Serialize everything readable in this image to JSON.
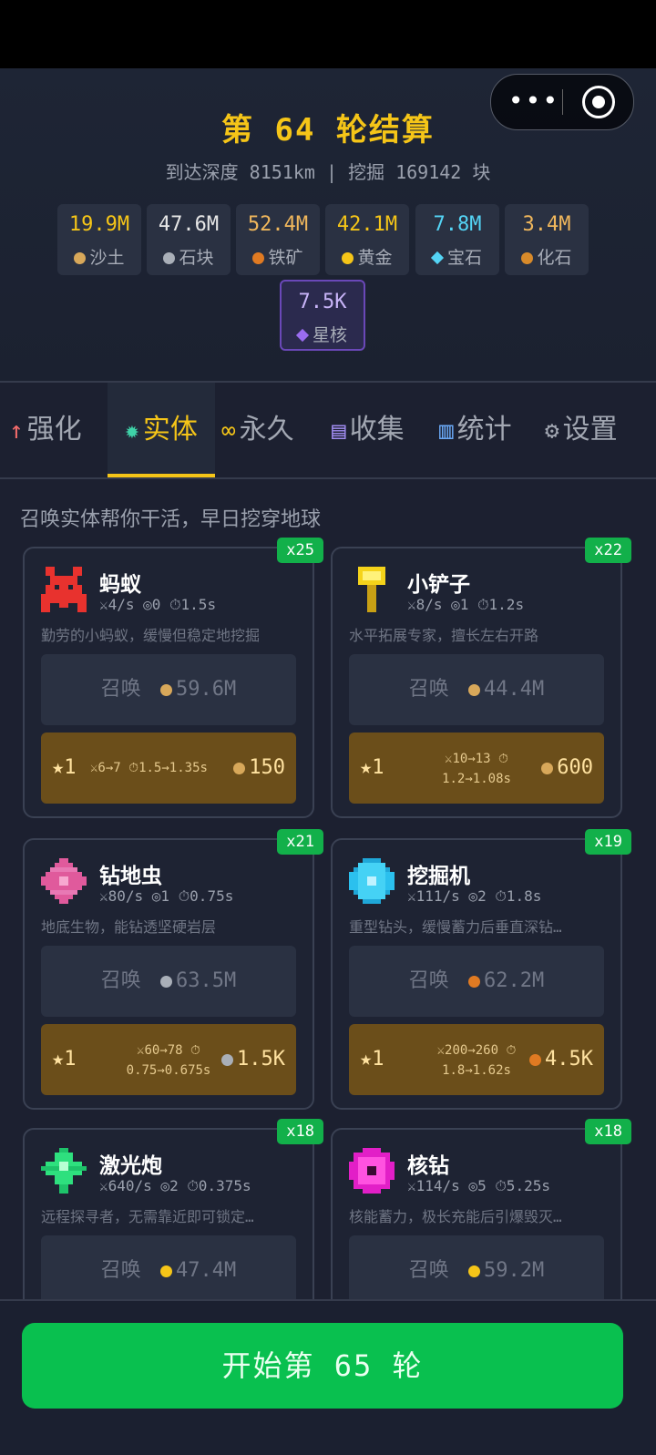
{
  "header": {
    "title": "第 64 轮结算",
    "subtitle": "到达深度 8151km | 挖掘 169142 块"
  },
  "resources": [
    {
      "value": "19.9M",
      "label": "沙土",
      "color": "#f5c518",
      "icon": "sand-icon"
    },
    {
      "value": "47.6M",
      "label": "石块",
      "color": "#e6e6e6",
      "icon": "stone-icon"
    },
    {
      "value": "52.4M",
      "label": "铁矿",
      "color": "#f0b75c",
      "icon": "iron-ore-icon"
    },
    {
      "value": "42.1M",
      "label": "黄金",
      "color": "#f5c518",
      "icon": "gold-icon"
    },
    {
      "value": "7.8M",
      "label": "宝石",
      "color": "#54d4f5",
      "icon": "gem-icon"
    },
    {
      "value": "3.4M",
      "label": "化石",
      "color": "#f0b75c",
      "icon": "fossil-icon"
    },
    {
      "value": "7.5K",
      "label": "星核",
      "color": "#b89cf5",
      "icon": "star-core-icon"
    }
  ],
  "tabs": [
    {
      "icon": "↑",
      "label": "强化",
      "icon_color": "#f26b6b"
    },
    {
      "icon": "✹",
      "label": "实体",
      "icon_color": "#3fd2a8"
    },
    {
      "icon": "∞",
      "label": "永久",
      "icon_color": "#f5c518"
    },
    {
      "icon": "▤",
      "label": "收集",
      "icon_color": "#a08cf0"
    },
    {
      "icon": "▥",
      "label": "统计",
      "icon_color": "#6aa8f5"
    },
    {
      "icon": "⚙",
      "label": "设置",
      "icon_color": "#a2a7b2"
    }
  ],
  "hint": "召唤实体帮你干活，早日挖穿地球",
  "entities": [
    {
      "name": "蚂蚁",
      "count": "x25",
      "stats": "⚔4/s ◎0 ⏱1.5s",
      "desc": "勤劳的小蚂蚁，缓慢但稳定地挖掘",
      "summon_label": "召唤",
      "summon_cost": "59.6M",
      "summon_icon": "sand-icon",
      "upgrade_level": "★1",
      "upgrade_line1": "⚔6→7 ⏱1.5→1.35s",
      "upgrade_line2": "",
      "upgrade_cost": "150",
      "upgrade_icon": "sand-icon"
    },
    {
      "name": "小铲子",
      "count": "x22",
      "stats": "⚔8/s ◎1 ⏱1.2s",
      "desc": "水平拓展专家，擅长左右开路",
      "summon_label": "召唤",
      "summon_cost": "44.4M",
      "summon_icon": "sand-icon",
      "upgrade_level": "★1",
      "upgrade_line1": "⚔10→13 ⏱",
      "upgrade_line2": "1.2→1.08s",
      "upgrade_cost": "600",
      "upgrade_icon": "sand-icon"
    },
    {
      "name": "钻地虫",
      "count": "x21",
      "stats": "⚔80/s ◎1 ⏱0.75s",
      "desc": "地底生物，能钻透坚硬岩层",
      "summon_label": "召唤",
      "summon_cost": "63.5M",
      "summon_icon": "stone-icon",
      "upgrade_level": "★1",
      "upgrade_line1": "⚔60→78 ⏱",
      "upgrade_line2": "0.75→0.675s",
      "upgrade_cost": "1.5K",
      "upgrade_icon": "stone-icon"
    },
    {
      "name": "挖掘机",
      "count": "x19",
      "stats": "⚔111/s ◎2 ⏱1.8s",
      "desc": "重型钻头，缓慢蓄力后垂直深钻…",
      "summon_label": "召唤",
      "summon_cost": "62.2M",
      "summon_icon": "iron-ore-icon",
      "upgrade_level": "★1",
      "upgrade_line1": "⚔200→260 ⏱",
      "upgrade_line2": "1.8→1.62s",
      "upgrade_cost": "4.5K",
      "upgrade_icon": "iron-ore-icon"
    },
    {
      "name": "激光炮",
      "count": "x18",
      "stats": "⚔640/s ◎2 ⏱0.375s",
      "desc": "远程探寻者，无需靠近即可锁定…",
      "summon_label": "召唤",
      "summon_cost": "47.4M",
      "summon_icon": "gold-icon"
    },
    {
      "name": "核钻",
      "count": "x18",
      "stats": "⚔114/s ◎5 ⏱5.25s",
      "desc": "核能蓄力，极长充能后引爆毁灭…",
      "summon_label": "召唤",
      "summon_cost": "59.2M",
      "summon_icon": "gold-icon"
    }
  ],
  "start_button": "开始第 65 轮",
  "colors": {
    "accent": "#f5c518",
    "start_green": "#09c04f",
    "badge_green": "#12b04a",
    "upgrade_brown": "#6b4e1a"
  }
}
